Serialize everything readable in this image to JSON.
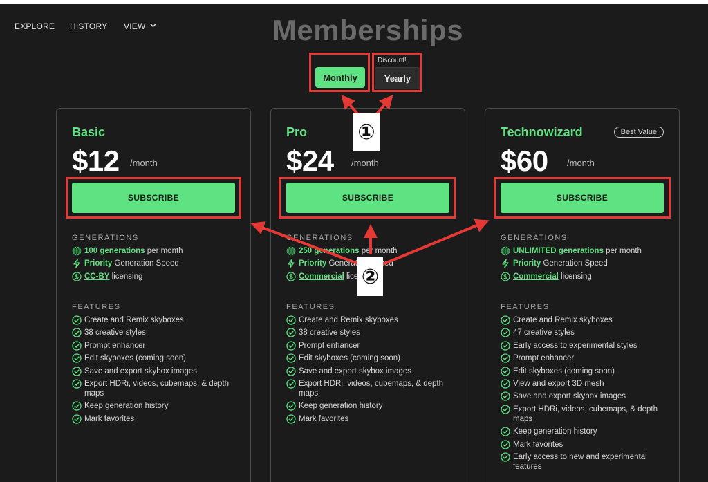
{
  "nav": {
    "explore": "EXPLORE",
    "history": "HISTORY",
    "view": "VIEW"
  },
  "page": {
    "title": "Memberships"
  },
  "billing": {
    "monthly": "Monthly",
    "yearly": "Yearly",
    "discount": "Discount!"
  },
  "annotations": {
    "one": "①",
    "two": "②"
  },
  "icons": {
    "chevron": "chevron-down-icon",
    "globe": "globe-icon",
    "bolt": "bolt-icon",
    "dollar": "dollar-circle-icon",
    "check": "check-circle-icon"
  },
  "colors": {
    "accent": "#5fe382",
    "background": "#1b1b1b",
    "annotation": "#e53935"
  },
  "plans": [
    {
      "name": "Basic",
      "price": "$12",
      "per": "/month",
      "subscribe": "SUBSCRIBE",
      "generations_title": "GENERATIONS",
      "gen_count_hl": "100 generations",
      "gen_count_rest": " per month",
      "speed_hl": "Priority",
      "speed_rest": " Generation Speed",
      "license_hl": "CC-BY",
      "license_rest": " licensing",
      "features_title": "FEATURES",
      "features": [
        "Create and Remix skyboxes",
        "38 creative styles",
        "Prompt enhancer",
        "Edit skyboxes (coming soon)",
        "Save and export skybox images",
        "Export HDRi, videos, cubemaps, & depth maps",
        "Keep generation history",
        "Mark favorites"
      ]
    },
    {
      "name": "Pro",
      "price": "$24",
      "per": "/month",
      "subscribe": "SUBSCRIBE",
      "generations_title": "GENERATIONS",
      "gen_count_hl": "250 generations",
      "gen_count_rest": " per month",
      "speed_hl": "Priority",
      "speed_rest": " Generation Speed",
      "license_hl": "Commercial",
      "license_rest": " licensing",
      "features_title": "FEATURES",
      "features": [
        "Create and Remix skyboxes",
        "38 creative styles",
        "Prompt enhancer",
        "Edit skyboxes (coming soon)",
        "Save and export skybox images",
        "Export HDRi, videos, cubemaps, & depth maps",
        "Keep generation history",
        "Mark favorites"
      ]
    },
    {
      "name": "Technowizard",
      "badge": "Best Value",
      "price": "$60",
      "per": "/month",
      "subscribe": "SUBSCRIBE",
      "generations_title": "GENERATIONS",
      "gen_count_hl": "UNLIMITED generations",
      "gen_count_rest": " per month",
      "speed_hl": "Priority",
      "speed_rest": " Generation Speed",
      "license_hl": "Commercial",
      "license_rest": " licensing",
      "features_title": "FEATURES",
      "features": [
        "Create and Remix skyboxes",
        "47 creative styles",
        "Early access to experimental styles",
        "Prompt enhancer",
        "Edit skyboxes (coming soon)",
        "View and export 3D mesh",
        "Save and export skybox images",
        "Export HDRi, videos, cubemaps, & depth maps",
        "Keep generation history",
        "Mark favorites",
        "Early access to new and experimental features"
      ]
    }
  ]
}
